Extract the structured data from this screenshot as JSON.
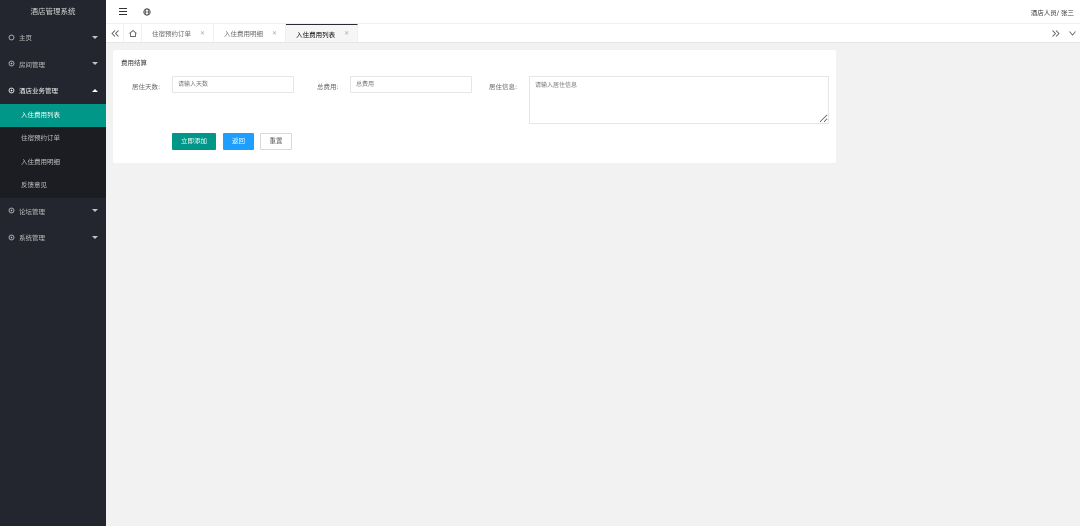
{
  "app": {
    "title": "酒店管理系统"
  },
  "sidebar": {
    "items": [
      {
        "label": "主页",
        "icon": "home-icon"
      },
      {
        "label": "房间管理",
        "icon": "gear-icon"
      },
      {
        "label": "酒店业务管理",
        "icon": "gear-icon",
        "children": [
          {
            "label": "入住费用列表",
            "active": true
          },
          {
            "label": "住宿预约订单"
          },
          {
            "label": "入住费用明细"
          },
          {
            "label": "反馈意见"
          }
        ]
      },
      {
        "label": "论坛管理",
        "icon": "gear-icon"
      },
      {
        "label": "系统管理",
        "icon": "gear-icon"
      }
    ]
  },
  "header": {
    "user": "酒店人员",
    "separator": "/",
    "name": "张三"
  },
  "tabs": [
    {
      "label": "住宿预约订单"
    },
    {
      "label": "入住费用明细"
    },
    {
      "label": "入住费用列表",
      "active": true
    }
  ],
  "form": {
    "title": "费用结算",
    "days_label": "居住天数:",
    "days_placeholder": "请输入天数",
    "total_label": "总费用:",
    "total_placeholder": "总费用",
    "info_label": "居住信息:",
    "info_placeholder": "请输入居住信息",
    "submit_label": "立即添加",
    "back_label": "返回",
    "reset_label": "重置"
  },
  "colors": {
    "sidebar": "#23262e",
    "accent": "#009688",
    "blue": "#1e9fff"
  }
}
